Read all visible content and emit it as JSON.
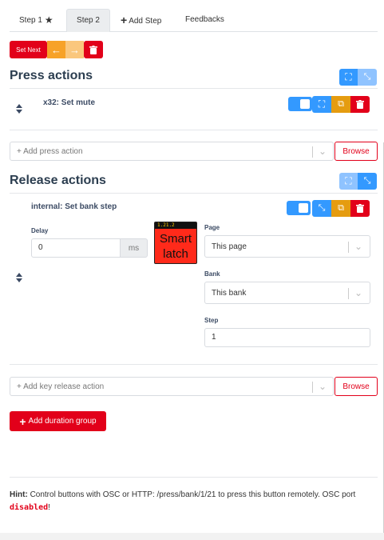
{
  "tabs": [
    {
      "label": "Step 1",
      "icon": "star-icon"
    },
    {
      "label": "Step 2"
    },
    {
      "label": "Add Step",
      "icon": "plus-icon"
    },
    {
      "label": "Feedbacks"
    }
  ],
  "toolbar": {
    "set_next": "Set Next"
  },
  "press": {
    "title": "Press actions",
    "action_name": "x32: Set mute",
    "add_placeholder": "+ Add press action",
    "browse": "Browse"
  },
  "release": {
    "title": "Release actions",
    "action_name": "internal: Set bank step",
    "delay_label": "Delay",
    "delay_value": "0",
    "delay_unit": "ms",
    "page_label": "Page",
    "page_value": "This page",
    "bank_label": "Bank",
    "bank_value": "This bank",
    "step_label": "Step",
    "step_value": "1",
    "add_placeholder": "+ Add key release action",
    "browse": "Browse",
    "preview_topbar": "1.21.2",
    "preview_line1": "Smart",
    "preview_line2": "latch"
  },
  "add_duration_group": "Add duration group",
  "hint": {
    "prefix": "Hint:",
    "text": "Control buttons with OSC or HTTP: /press/bank/1/21 to press this button remotely. OSC port",
    "status": "disabled",
    "suffix": "!"
  },
  "colors": {
    "accent_red": "#e2001a",
    "accent_blue": "#3399ff",
    "accent_orange": "#f7a228"
  }
}
